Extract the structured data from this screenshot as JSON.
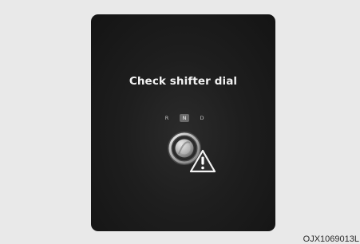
{
  "screen": {
    "message": "Check shifter dial",
    "gears": [
      "R",
      "N",
      "D"
    ],
    "highlighted_gear": "N"
  },
  "icons": {
    "dial": "shifter-dial-icon",
    "warning": "warning-triangle-icon"
  },
  "footer": {
    "code": "OJX1069013L"
  },
  "colors": {
    "background": "#e9e9e9",
    "panel": "#1e1e1e",
    "text": "#f2f2f2"
  }
}
